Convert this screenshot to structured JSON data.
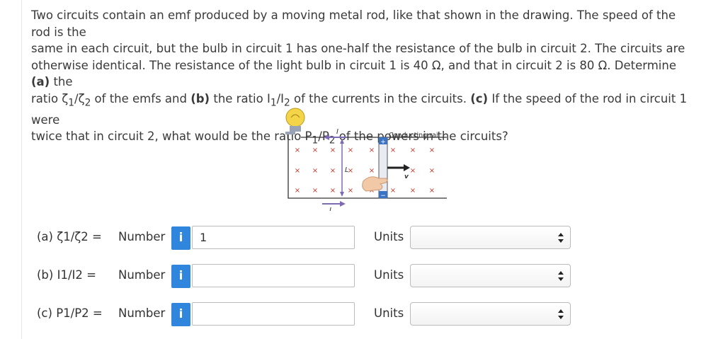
{
  "question": {
    "line1": "Two circuits contain an emf produced by a moving metal rod, like that shown in the drawing. The speed of the rod is the",
    "line2": "same in each circuit, but the bulb in circuit 1 has one-half the resistance of the bulb in circuit 2. The circuits are",
    "line3a": "otherwise identical. The resistance of the light bulb in circuit 1 is 40 Ω, and that in circuit 2 is 80 Ω. Determine ",
    "line3b": "(a)",
    "line3c": " the",
    "line4a": "ratio ζ",
    "line4b": "1",
    "line4c": "/ζ",
    "line4d": "2",
    "line4e": " of the emfs and ",
    "line4f": "(b)",
    "line4g": " the ratio I",
    "line4h": "1",
    "line4i": "/I",
    "line4j": "2",
    "line4k": " of the currents in the circuits. ",
    "line4l": "(c)",
    "line4m": " If the speed of the rod in circuit 1 were",
    "line5a": "twice that in circuit 2, what would be the ratio P",
    "line5b": "1",
    "line5c": "/P",
    "line5d": "2",
    "line5e": " of the powers in the circuits?"
  },
  "diagram": {
    "rail_label": "Conducting rail",
    "current_label": "I",
    "length_label": "L",
    "velocity_label": "v",
    "plus": "+",
    "minus": "−",
    "cross": "×"
  },
  "answers": [
    {
      "label": "(a)  ζ1/ζ2 =",
      "number_label": "Number",
      "info": "i",
      "value": "1",
      "units_label": "Units",
      "units_value": ""
    },
    {
      "label": "(b)  I1/I2 =",
      "number_label": "Number",
      "info": "i",
      "value": "",
      "units_label": "Units",
      "units_value": ""
    },
    {
      "label": "(c)  P1/P2 =",
      "number_label": "Number",
      "info": "i",
      "value": "",
      "units_label": "Units",
      "units_value": ""
    }
  ],
  "colors": {
    "info_blue": "#2f86dc",
    "rail": "#333333",
    "arrow_purple": "#7d6bb3",
    "bulb": "#f4d54a",
    "hand": "#f2c9a6"
  }
}
